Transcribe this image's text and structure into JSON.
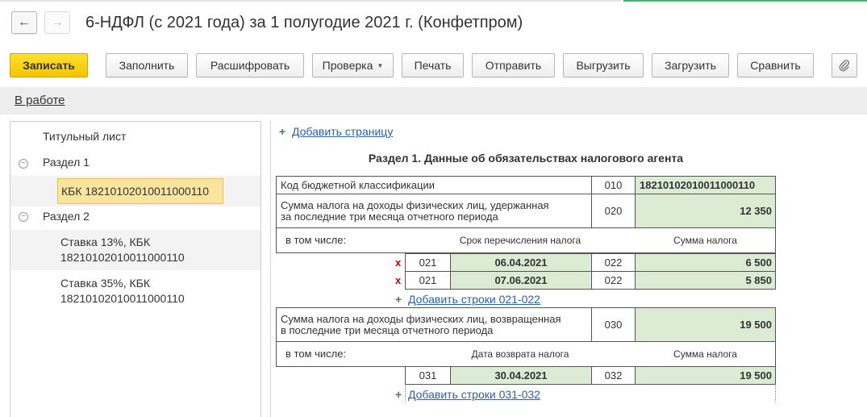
{
  "header": {
    "back_label": "←",
    "forward_label": "→",
    "title": "6-НДФЛ (с 2021 года) за 1 полугодие 2021 г. (Конфетпром)"
  },
  "toolbar": {
    "save": "Записать",
    "fill": "Заполнить",
    "decode": "Расшифровать",
    "check": "Проверка",
    "print": "Печать",
    "send": "Отправить",
    "export": "Выгрузить",
    "import": "Загрузить",
    "compare": "Сравнить",
    "attach_icon": "paperclip-icon"
  },
  "status": {
    "label": "В работе"
  },
  "tree": {
    "title_page": "Титульный лист",
    "section1": "Раздел 1",
    "kbk_selected": "КБК 18210102010011000110",
    "section2": "Раздел 2",
    "rate13_line1": "Ставка 13%, КБК",
    "rate13_line2": "18210102010011000110",
    "rate35_line1": "Ставка 35%, КБК",
    "rate35_line2": "18210102010011000110"
  },
  "form": {
    "add_page": "Добавить страницу",
    "section_title": "Раздел 1. Данные об обязательствах налогового агента",
    "kbk_label": "Код бюджетной классификации",
    "kbk_code": "010",
    "kbk_value": "18210102010011000110",
    "withheld_label_1": "Сумма налога на доходы физических лиц, удержанная",
    "withheld_label_2": "за последние три месяца отчетного периода",
    "withheld_code": "020",
    "withheld_value": "12 350",
    "incl_label": "в том числе:",
    "hdr_transfer_date": "Срок перечисления налога",
    "hdr_tax_sum": "Сумма налога",
    "rows_021": [
      {
        "del": "x",
        "code": "021",
        "date": "06.04.2021",
        "code2": "022",
        "sum": "6 500"
      },
      {
        "del": "x",
        "code": "021",
        "date": "07.06.2021",
        "code2": "022",
        "sum": "5 850"
      }
    ],
    "add_rows_021": "Добавить строки 021-022",
    "returned_label_1": "Сумма налога на доходы физических лиц, возвращенная",
    "returned_label_2": "в последние три месяца отчетного периода",
    "returned_code": "030",
    "returned_value": "19 500",
    "incl_label_2": "в том числе:",
    "hdr_return_date": "Дата возврата налога",
    "hdr_tax_sum_2": "Сумма налога",
    "row_031": {
      "code": "031",
      "date": "30.04.2021",
      "code2": "032",
      "sum": "19 500"
    },
    "add_rows_031": "Добавить строки 031-032"
  }
}
